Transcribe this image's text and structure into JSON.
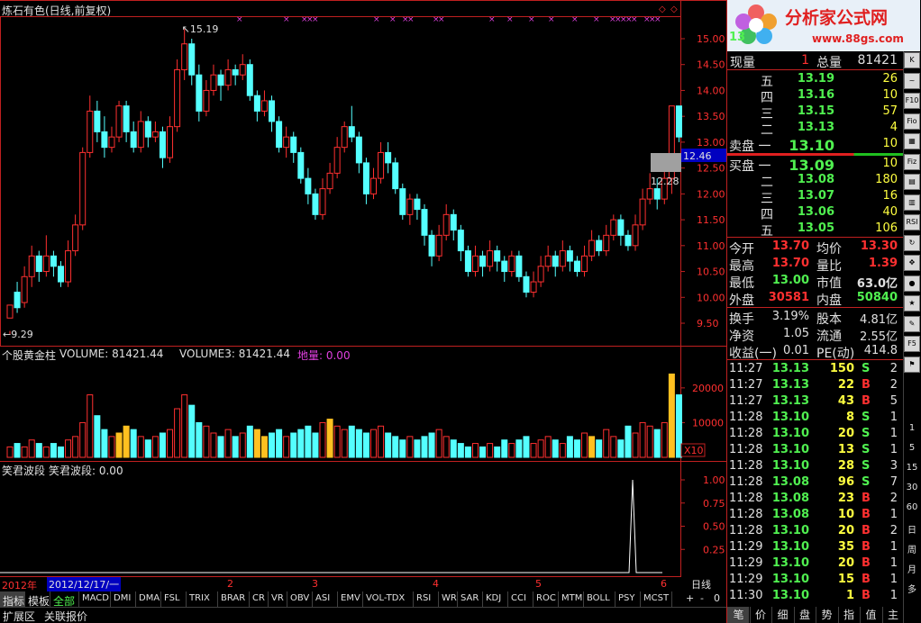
{
  "chart_data": {
    "type": "candlestick",
    "title": "炼石有色(日线,前复权)",
    "price_axis": {
      "ylim": [
        9.1,
        15.4
      ],
      "ticks": [
        "15.00",
        "14.50",
        "14.00",
        "13.50",
        "13.00",
        "12.50",
        "12.00",
        "11.50",
        "11.00",
        "10.50",
        "10.00",
        "9.50"
      ]
    },
    "annotations": {
      "high": "15.19",
      "low": "9.29",
      "right_mark": "12.28",
      "current_price_tag": "12.46"
    },
    "x_labels": [
      "2",
      "3",
      "4",
      "5",
      "6"
    ],
    "volume_panel": {
      "title": "个股黄金柱",
      "volume_label": "VOLUME: 81421.44",
      "volume3_label": "VOLUME3: 81421.44",
      "land_label": "地量: 0.00",
      "ticks": [
        "20000",
        "10000"
      ],
      "multiplier": "X10"
    },
    "indicator_panel": {
      "title": "笑君波段",
      "value_label": "笑君波段: 0.00",
      "ticks": [
        "1.00",
        "0.75",
        "0.50",
        "0.25"
      ],
      "pulse_index": 86
    },
    "candles": [
      [
        9.6,
        9.85,
        9.35,
        9.29
      ],
      [
        10.1,
        9.8,
        10.3,
        9.7
      ],
      [
        9.9,
        10.4,
        10.6,
        9.8
      ],
      [
        10.4,
        10.8,
        11.0,
        10.2
      ],
      [
        10.8,
        10.5,
        10.9,
        10.3
      ],
      [
        10.5,
        10.8,
        11.2,
        10.4
      ],
      [
        10.8,
        10.6,
        10.9,
        10.4
      ],
      [
        10.6,
        10.3,
        10.7,
        10.2
      ],
      [
        10.3,
        10.9,
        11.1,
        10.2
      ],
      [
        10.9,
        11.4,
        11.6,
        10.8
      ],
      [
        11.4,
        12.8,
        12.9,
        11.3
      ],
      [
        12.8,
        13.6,
        13.9,
        12.7
      ],
      [
        13.6,
        13.2,
        13.8,
        13.0
      ],
      [
        13.2,
        12.9,
        13.5,
        12.7
      ],
      [
        12.9,
        13.1,
        13.3,
        12.8
      ],
      [
        13.1,
        13.7,
        13.8,
        13.0
      ],
      [
        13.7,
        13.2,
        13.8,
        13.0
      ],
      [
        13.2,
        12.9,
        13.4,
        12.8
      ],
      [
        12.9,
        13.4,
        13.6,
        12.8
      ],
      [
        13.4,
        13.1,
        13.5,
        12.9
      ],
      [
        13.1,
        13.2,
        13.4,
        13.0
      ],
      [
        13.2,
        12.7,
        13.3,
        12.5
      ],
      [
        12.7,
        13.3,
        13.5,
        12.6
      ],
      [
        13.3,
        14.4,
        14.6,
        13.2
      ],
      [
        14.4,
        14.9,
        15.19,
        14.2
      ],
      [
        14.9,
        14.3,
        15.0,
        14.1
      ],
      [
        14.3,
        13.6,
        14.5,
        13.4
      ],
      [
        13.6,
        14.0,
        14.2,
        13.5
      ],
      [
        14.0,
        14.3,
        14.5,
        13.9
      ],
      [
        14.3,
        14.1,
        14.4,
        13.8
      ],
      [
        14.1,
        14.4,
        14.6,
        14.0
      ],
      [
        14.4,
        14.3,
        14.5,
        14.1
      ],
      [
        14.3,
        14.5,
        14.7,
        14.2
      ],
      [
        14.5,
        13.9,
        14.6,
        13.8
      ],
      [
        13.9,
        13.6,
        14.0,
        13.4
      ],
      [
        13.6,
        13.8,
        14.0,
        13.5
      ],
      [
        13.8,
        13.4,
        13.9,
        13.2
      ],
      [
        13.4,
        12.9,
        13.5,
        12.8
      ],
      [
        12.9,
        13.1,
        13.3,
        12.7
      ],
      [
        13.1,
        12.8,
        13.2,
        12.6
      ],
      [
        12.8,
        12.3,
        12.9,
        12.2
      ],
      [
        12.3,
        12.0,
        12.5,
        11.8
      ],
      [
        12.0,
        11.6,
        12.1,
        11.5
      ],
      [
        11.6,
        12.1,
        12.3,
        11.5
      ],
      [
        12.1,
        12.4,
        12.6,
        12.0
      ],
      [
        12.4,
        12.9,
        13.1,
        12.3
      ],
      [
        12.9,
        13.3,
        13.4,
        12.8
      ],
      [
        13.3,
        13.1,
        13.7,
        13.0
      ],
      [
        13.1,
        12.6,
        13.2,
        12.4
      ],
      [
        12.6,
        12.0,
        12.7,
        11.8
      ],
      [
        12.0,
        12.3,
        12.5,
        11.9
      ],
      [
        12.3,
        12.8,
        13.0,
        12.2
      ],
      [
        12.8,
        12.6,
        13.0,
        12.4
      ],
      [
        12.6,
        12.1,
        12.7,
        12.0
      ],
      [
        12.1,
        11.6,
        12.2,
        11.5
      ],
      [
        11.6,
        11.9,
        12.0,
        11.4
      ],
      [
        11.9,
        11.7,
        12.0,
        11.5
      ],
      [
        11.7,
        11.2,
        11.8,
        11.0
      ],
      [
        11.2,
        10.8,
        11.3,
        10.6
      ],
      [
        10.8,
        11.2,
        11.4,
        10.7
      ],
      [
        11.2,
        11.6,
        11.8,
        11.1
      ],
      [
        11.6,
        11.3,
        11.7,
        11.1
      ],
      [
        11.3,
        10.9,
        11.4,
        10.7
      ],
      [
        10.9,
        10.5,
        11.0,
        10.4
      ],
      [
        10.5,
        10.8,
        11.0,
        10.4
      ],
      [
        10.8,
        10.6,
        10.9,
        10.4
      ],
      [
        10.6,
        10.9,
        11.1,
        10.5
      ],
      [
        10.9,
        10.7,
        11.0,
        10.5
      ],
      [
        10.7,
        10.5,
        10.8,
        10.3
      ],
      [
        10.5,
        10.8,
        10.9,
        10.4
      ],
      [
        10.8,
        10.4,
        10.9,
        10.3
      ],
      [
        10.4,
        10.1,
        10.5,
        10.0
      ],
      [
        10.1,
        10.3,
        10.5,
        10.0
      ],
      [
        10.3,
        10.6,
        10.8,
        10.2
      ],
      [
        10.6,
        10.8,
        11.0,
        10.5
      ],
      [
        10.8,
        10.6,
        10.9,
        10.4
      ],
      [
        10.6,
        10.9,
        11.1,
        10.5
      ],
      [
        10.9,
        10.7,
        11.0,
        10.5
      ],
      [
        10.7,
        10.5,
        10.8,
        10.4
      ],
      [
        10.5,
        10.8,
        11.0,
        10.4
      ],
      [
        10.8,
        11.1,
        11.3,
        10.7
      ],
      [
        11.1,
        10.9,
        11.2,
        10.8
      ],
      [
        10.9,
        11.2,
        11.4,
        10.8
      ],
      [
        11.2,
        11.5,
        11.6,
        11.1
      ],
      [
        11.5,
        11.2,
        11.6,
        11.0
      ],
      [
        11.2,
        11.0,
        11.3,
        10.9
      ],
      [
        11.0,
        11.4,
        11.6,
        10.9
      ],
      [
        11.4,
        11.9,
        12.1,
        11.3
      ],
      [
        11.9,
        12.1,
        12.4,
        11.8
      ],
      [
        12.1,
        11.9,
        12.3,
        11.7
      ],
      [
        11.9,
        12.3,
        12.5,
        11.8
      ],
      [
        12.3,
        13.7,
        13.7,
        12.0
      ],
      [
        13.7,
        13.1,
        13.7,
        13.0
      ]
    ],
    "volumes": [
      3,
      4,
      3,
      5,
      4,
      3,
      4,
      3,
      5,
      6,
      10,
      18,
      12,
      8,
      6,
      7,
      9,
      8,
      6,
      5,
      6,
      7,
      8,
      14,
      18,
      15,
      10,
      9,
      7,
      6,
      8,
      6,
      7,
      9,
      8,
      6,
      7,
      8,
      6,
      7,
      8,
      9,
      7,
      10,
      11,
      9,
      8,
      9,
      8,
      7,
      8,
      9,
      7,
      6,
      5,
      6,
      5,
      6,
      7,
      8,
      6,
      5,
      4,
      3,
      4,
      3,
      4,
      3,
      5,
      4,
      5,
      6,
      4,
      5,
      6,
      5,
      4,
      6,
      5,
      7,
      6,
      5,
      8,
      6,
      5,
      9,
      7,
      10,
      9,
      8,
      10,
      24,
      18
    ],
    "volume_colors_gold": [
      15,
      16,
      34,
      35,
      44,
      80,
      91
    ]
  },
  "right_panel": {
    "logo_text": "分析家公式网",
    "logo_url_text": "www.88gs.com",
    "logo_code": "13",
    "row_xianliang": {
      "label": "现量",
      "value": "1",
      "label2": "总量",
      "value2": "81421"
    },
    "asks": [
      {
        "label": "五",
        "price": "13.19",
        "vol": "26"
      },
      {
        "label": "四",
        "price": "13.16",
        "vol": "10"
      },
      {
        "label": "三",
        "price": "13.15",
        "vol": "57"
      },
      {
        "label": "二",
        "price": "13.13",
        "vol": "4"
      },
      {
        "label": "卖盘 一",
        "price": "13.10",
        "vol": "10"
      }
    ],
    "bids": [
      {
        "label": "买盘 一",
        "price": "13.09",
        "vol": "10"
      },
      {
        "label": "二",
        "price": "13.08",
        "vol": "180"
      },
      {
        "label": "三",
        "price": "13.07",
        "vol": "16"
      },
      {
        "label": "四",
        "price": "13.06",
        "vol": "40"
      },
      {
        "label": "五",
        "price": "13.05",
        "vol": "106"
      }
    ],
    "stats": [
      {
        "l1": "今开",
        "v1": "13.70",
        "c1": "#ff3030",
        "l2": "均价",
        "v2": "13.30",
        "c2": "#ff3030"
      },
      {
        "l1": "最高",
        "v1": "13.70",
        "c1": "#ff3030",
        "l2": "量比",
        "v2": "1.39",
        "c2": "#ff3030"
      },
      {
        "l1": "最低",
        "v1": "13.00",
        "c1": "#50f050",
        "l2": "市值",
        "v2": "63.0亿",
        "c2": "#e0e0e0"
      },
      {
        "l1": "外盘",
        "v1": "30581",
        "c1": "#ff3030",
        "l2": "内盘",
        "v2": "50840",
        "c2": "#50f050"
      }
    ],
    "stats2": [
      {
        "l1": "换手",
        "v1": "3.19%",
        "l2": "股本",
        "v2": "4.81亿"
      },
      {
        "l1": "净资",
        "v1": "1.05",
        "l2": "流通",
        "v2": "2.55亿"
      },
      {
        "l1": "收益(一)",
        "v1": "0.01",
        "l2": "PE(动)",
        "v2": "414.8"
      }
    ],
    "ticks": [
      {
        "t": "11:27",
        "p": "13.13",
        "v": "150",
        "s": "S",
        "n": "2"
      },
      {
        "t": "11:27",
        "p": "13.13",
        "v": "22",
        "s": "B",
        "n": "2"
      },
      {
        "t": "11:27",
        "p": "13.13",
        "v": "43",
        "s": "B",
        "n": "5"
      },
      {
        "t": "11:28",
        "p": "13.10",
        "v": "8",
        "s": "S",
        "n": "1"
      },
      {
        "t": "11:28",
        "p": "13.10",
        "v": "20",
        "s": "S",
        "n": "1"
      },
      {
        "t": "11:28",
        "p": "13.10",
        "v": "13",
        "s": "S",
        "n": "1"
      },
      {
        "t": "11:28",
        "p": "13.10",
        "v": "28",
        "s": "S",
        "n": "3"
      },
      {
        "t": "11:28",
        "p": "13.08",
        "v": "96",
        "s": "S",
        "n": "7"
      },
      {
        "t": "11:28",
        "p": "13.08",
        "v": "23",
        "s": "B",
        "n": "2"
      },
      {
        "t": "11:28",
        "p": "13.08",
        "v": "10",
        "s": "B",
        "n": "1"
      },
      {
        "t": "11:28",
        "p": "13.10",
        "v": "20",
        "s": "B",
        "n": "2"
      },
      {
        "t": "11:29",
        "p": "13.10",
        "v": "35",
        "s": "B",
        "n": "1"
      },
      {
        "t": "11:29",
        "p": "13.10",
        "v": "20",
        "s": "B",
        "n": "1"
      },
      {
        "t": "11:29",
        "p": "13.10",
        "v": "15",
        "s": "B",
        "n": "1"
      },
      {
        "t": "11:30",
        "p": "13.10",
        "v": "1",
        "s": "B",
        "n": "1"
      }
    ],
    "tabs": [
      "笔",
      "价",
      "细",
      "盘",
      "势",
      "指",
      "值",
      "主"
    ]
  },
  "bottom": {
    "year": "2012年",
    "date": "2012/12/17/一",
    "period": "日线",
    "tabs": [
      "指标",
      "模板",
      "全部",
      "MACD",
      "DMI",
      "DMA",
      "FSL",
      "TRIX",
      "BRAR",
      "CR",
      "VR",
      "OBV",
      "ASI",
      "EMV",
      "VOL-TDX",
      "RSI",
      "WR",
      "SAR",
      "KDJ",
      "CCI",
      "ROC",
      "MTM",
      "BOLL",
      "PSY",
      "MCST"
    ],
    "ctrl": [
      "+",
      "-",
      "0"
    ],
    "row2": [
      "扩展区",
      "关联报价"
    ]
  },
  "side_icons": [
    "k-line-icon",
    "trend-icon",
    "f10-icon",
    "fio-icon",
    "grid-icon",
    "fiz-icon",
    "table-icon",
    "chart-icon",
    "rsi-icon",
    "refresh-icon",
    "arrows-icon",
    "dot-icon",
    "star-icon",
    "pencil-icon",
    "f5-icon",
    "flag-icon"
  ],
  "side_chars": [
    "1",
    "5",
    "15",
    "30",
    "60",
    "日",
    "周",
    "月",
    "多"
  ]
}
